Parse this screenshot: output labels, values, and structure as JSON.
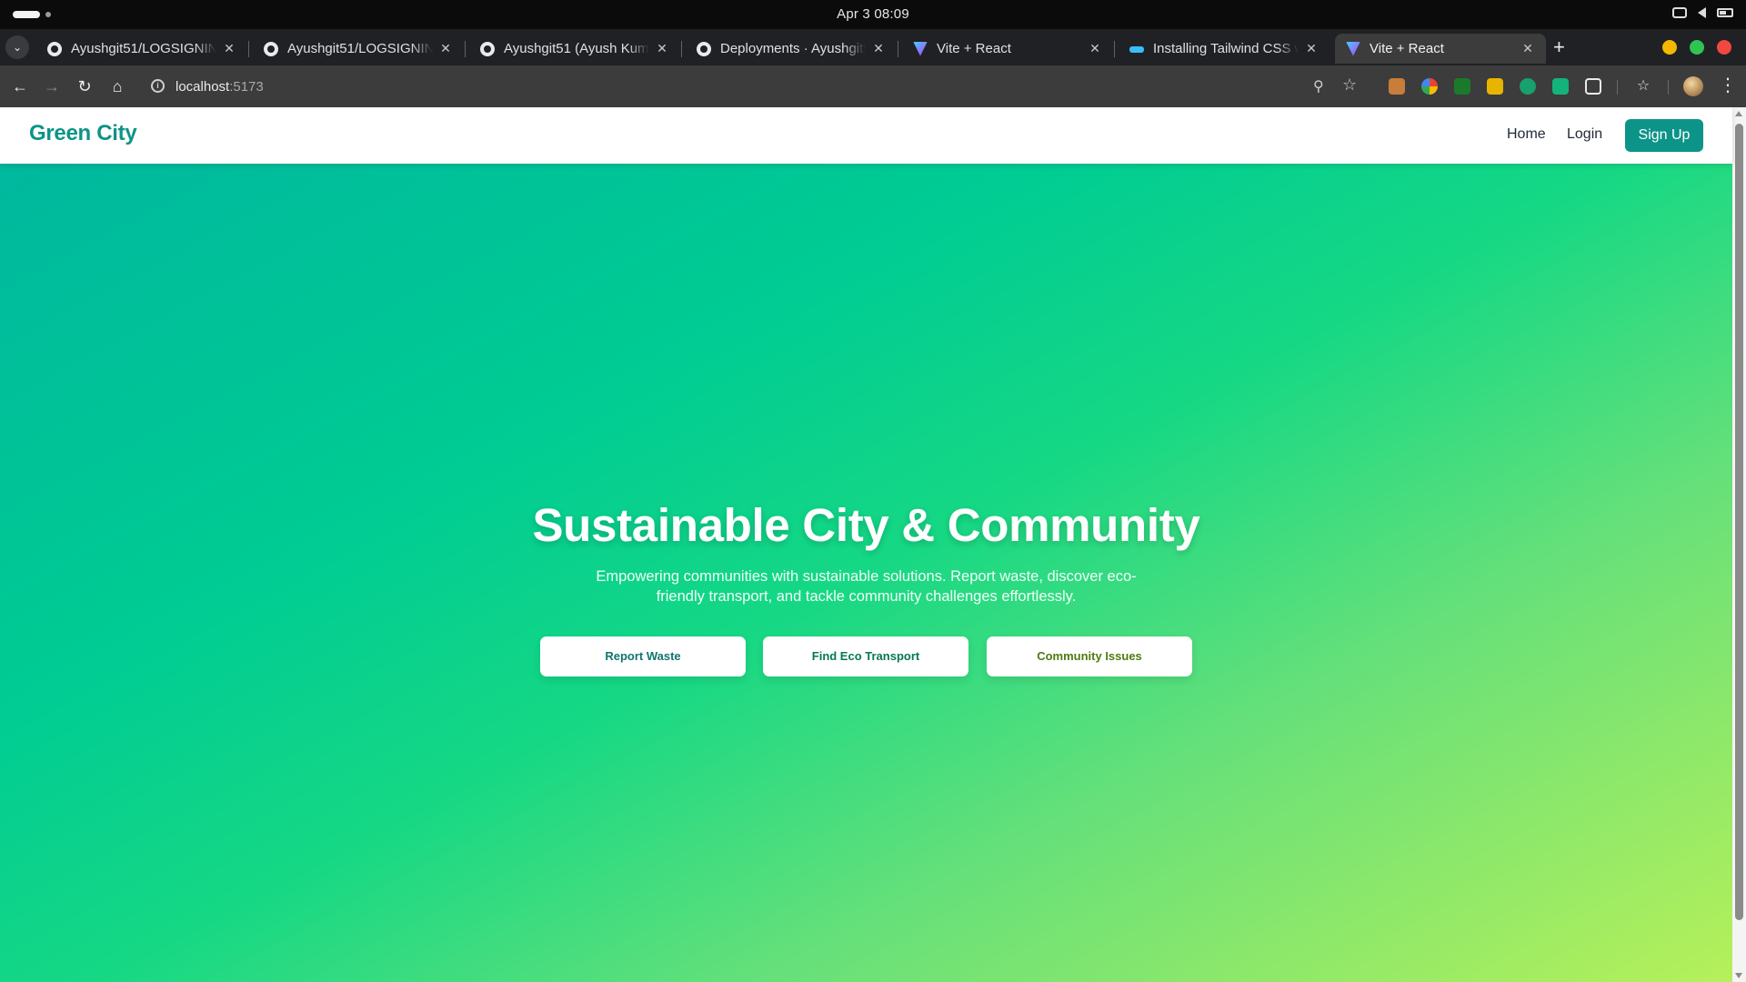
{
  "system": {
    "clock": "Apr 3  08:09"
  },
  "browser": {
    "tabs": [
      {
        "title": "Ayushgit51/LOGSIGNIN: ",
        "favicon": "github-icon"
      },
      {
        "title": "Ayushgit51/LOGSIGNIN: ",
        "favicon": "github-icon"
      },
      {
        "title": "Ayushgit51 (Ayush Kuma",
        "favicon": "github-icon"
      },
      {
        "title": "Deployments · Ayushgit5",
        "favicon": "github-icon"
      },
      {
        "title": "Vite + React",
        "favicon": "vite-icon"
      },
      {
        "title": "Installing Tailwind CSS w",
        "favicon": "tailwind-icon"
      },
      {
        "title": "Vite + React",
        "favicon": "vite-icon",
        "active": true
      }
    ],
    "url_host": "localhost",
    "url_port": ":5173",
    "window_colors": {
      "minimize": "#f5b800",
      "maximize": "#2fc451",
      "close": "#f2483f"
    }
  },
  "site": {
    "brand": "Green City",
    "nav": {
      "home": "Home",
      "login": "Login",
      "signup": "Sign Up"
    },
    "hero": {
      "title": "Sustainable City & Community",
      "subtitle": "Empowering communities with sustainable solutions. Report waste, discover eco-friendly transport, and tackle community challenges effortlessly.",
      "buttons": [
        {
          "label": "Report Waste",
          "color": "#0f766e"
        },
        {
          "label": "Find Eco Transport",
          "color": "#047857"
        },
        {
          "label": "Community Issues",
          "color": "#4d7c0f"
        }
      ]
    },
    "colors": {
      "accent": "#0d9488",
      "gradient_start": "#00b89e",
      "gradient_end": "#b6f05a"
    }
  }
}
